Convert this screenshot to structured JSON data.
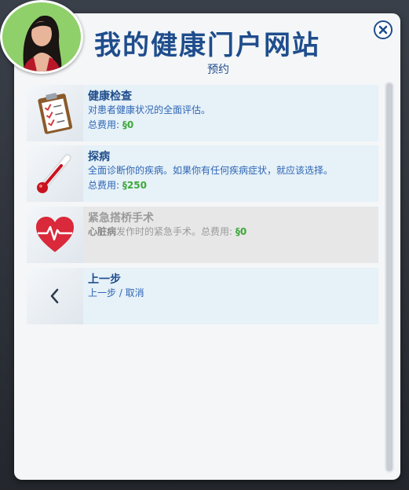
{
  "header": {
    "title": "我的健康门户网站",
    "subtitle": "预约"
  },
  "items": [
    {
      "name": "健康检查",
      "desc": "对患者健康状况的全面评估。",
      "cost_label": "总费用:",
      "cost_symbol": "§",
      "cost_value": "0",
      "icon": "clipboard-icon"
    },
    {
      "name": "探病",
      "desc": "全面诊断你的疾病。如果你有任何疾病症状，就应该选择。",
      "cost_label": "总费用:",
      "cost_symbol": "§",
      "cost_value": "250",
      "icon": "thermometer-icon"
    },
    {
      "name": "紧急搭桥手术",
      "desc_emph": "心脏病",
      "desc": "发作时的紧急手术。总费用:",
      "cost_symbol": "§",
      "cost_value": "0",
      "icon": "heart-monitor-icon"
    },
    {
      "name": "上一步",
      "desc": "上一步 / 取消",
      "icon": "chevron-left-icon"
    }
  ],
  "colors": {
    "title": "#1f4d8c",
    "money": "#3da83a",
    "item_bg": "#e6f1f8",
    "disabled_bg": "#e7e7e7"
  }
}
